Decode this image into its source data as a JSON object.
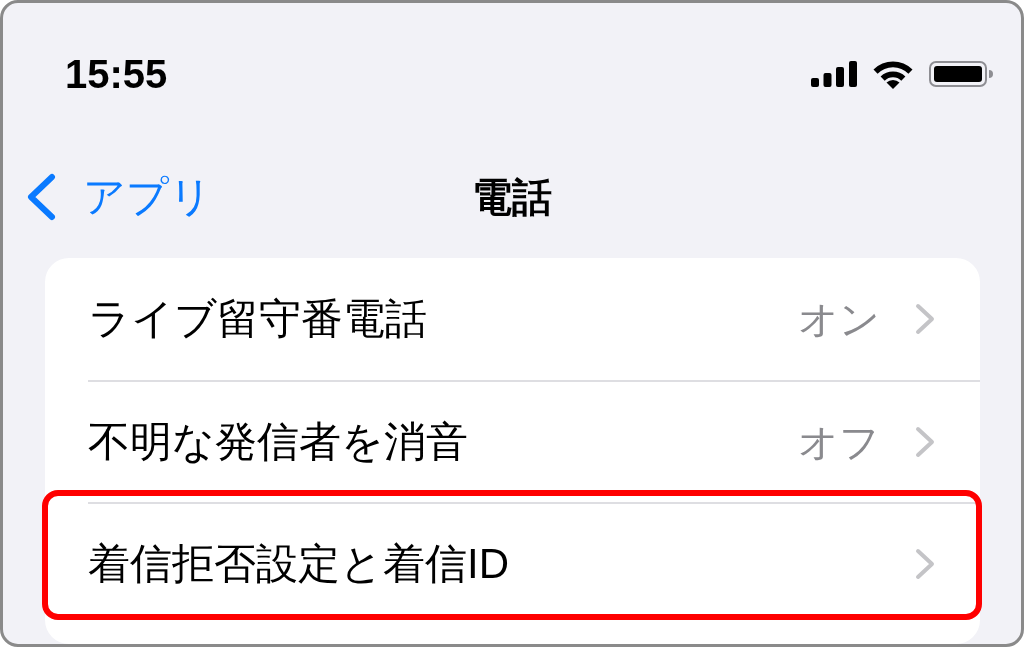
{
  "status_bar": {
    "time": "15:55"
  },
  "nav_bar": {
    "back_label": "アプリ",
    "title": "電話"
  },
  "rows": [
    {
      "label": "ライブ留守番電話",
      "value": "オン",
      "highlighted": false
    },
    {
      "label": "不明な発信者を消音",
      "value": "オフ",
      "highlighted": false
    },
    {
      "label": "着信拒否設定と着信ID",
      "highlighted": true
    }
  ]
}
